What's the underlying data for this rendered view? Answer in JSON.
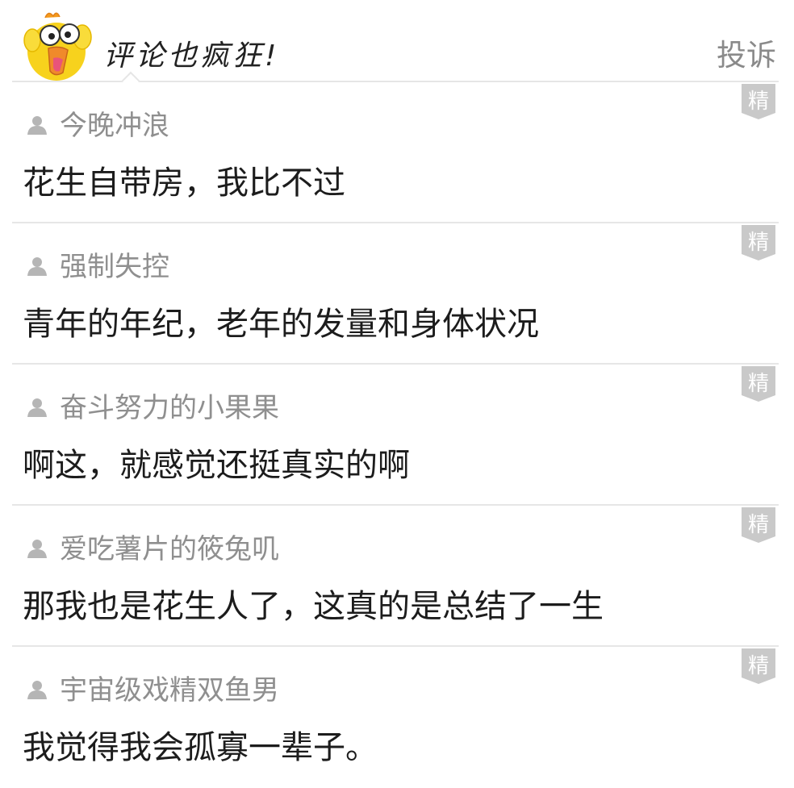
{
  "header": {
    "title": "评论也疯狂!",
    "report_label": "投诉",
    "mascot_icon": "yellow-chick-mascot-icon"
  },
  "badge_label": "精",
  "comments": [
    {
      "username": "今晚冲浪",
      "text": "花生自带房，我比不过"
    },
    {
      "username": "强制失控",
      "text": "青年的年纪，老年的发量和身体状况"
    },
    {
      "username": "奋斗努力的小果果",
      "text": "啊这，就感觉还挺真实的啊"
    },
    {
      "username": "爱吃薯片的筱兔叽",
      "text": "那我也是花生人了，这真的是总结了一生"
    },
    {
      "username": "宇宙级戏精双鱼男",
      "text": "我觉得我会孤寡一辈子。"
    }
  ],
  "colors": {
    "badge": "#c9c9c9",
    "username": "#8f8f8f",
    "text": "#1c1c1c",
    "mascot": "#f7d21d"
  }
}
